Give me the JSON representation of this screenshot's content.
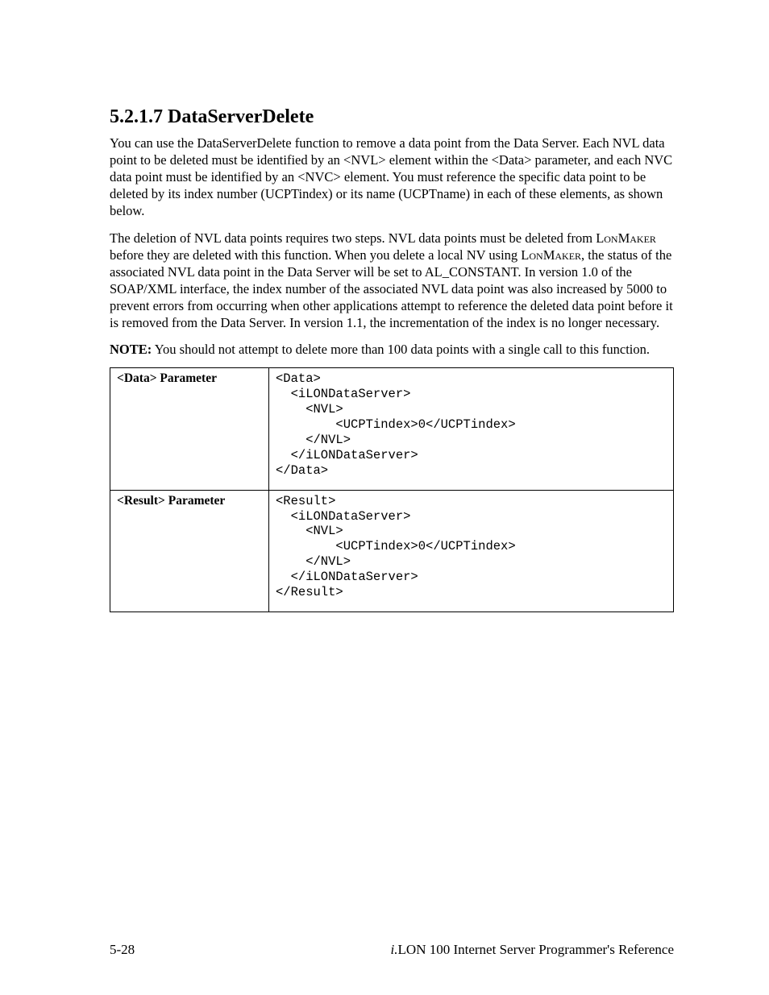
{
  "heading": "5.2.1.7 DataServerDelete",
  "para1": "You can use the DataServerDelete function to remove a data point from the Data Server. Each NVL data point to be deleted must be identified by an <NVL> element within the <Data> parameter, and each NVC data point must be identified by an <NVC> element. You must reference the specific data point to be deleted by its index number (UCPTindex) or its name (UCPTname) in each of these elements, as shown below.",
  "para2_a": "The deletion of NVL data points requires two steps. NVL data points must be deleted from ",
  "para2_lm1": "LonMaker",
  "para2_b": "  before they are deleted with this function. When you delete a local NV using ",
  "para2_lm2": "LonMaker",
  "para2_c": ", the status of the associated NVL data point in the Data Server will be set to AL_CONSTANT. In version 1.0 of the SOAP/XML interface, the index number of the associated NVL data point was also increased by 5000 to prevent errors from occurring when other applications attempt to reference the deleted data point before it is removed from the Data Server. In version 1.1, the incrementation of the index is no longer necessary.",
  "note_label": "NOTE:",
  "note_text": " You should not attempt to delete more than 100 data points with a single call to this function.",
  "table": {
    "row1_label": "<Data> Parameter",
    "row1_code": "<Data>\n  <iLONDataServer>\n    <NVL>\n        <UCPTindex>0</UCPTindex>\n    </NVL>\n  </iLONDataServer>\n</Data>",
    "row2_label": "<Result> Parameter",
    "row2_code": "<Result>\n  <iLONDataServer>\n    <NVL>\n        <UCPTindex>0</UCPTindex>\n    </NVL>\n  </iLONDataServer>\n</Result>"
  },
  "footer": {
    "page_number": "5-28",
    "book_prefix": "i.",
    "book_title": "LON 100 Internet Server Programmer's Reference"
  }
}
